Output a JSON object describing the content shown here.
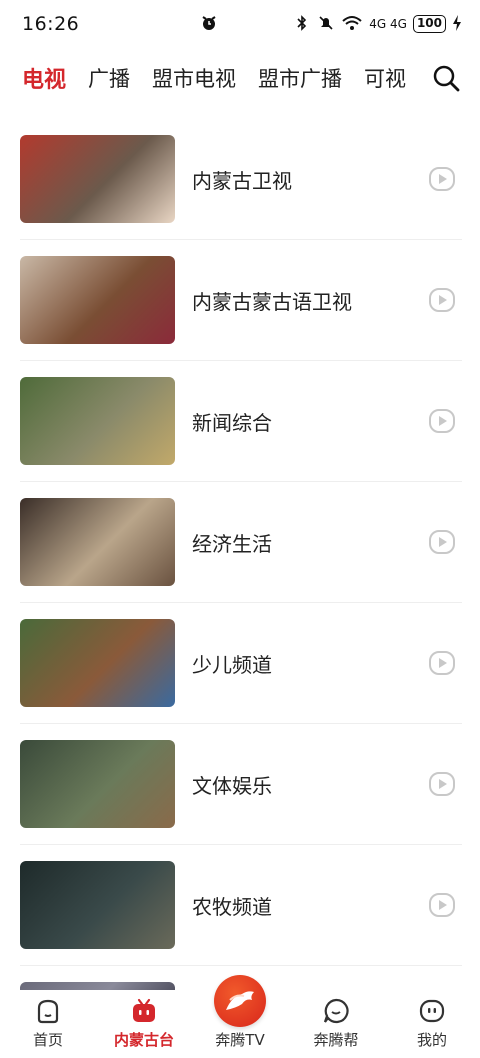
{
  "status_bar": {
    "time": "16:26",
    "network": "4G 4G",
    "battery": "100"
  },
  "top_tabs": [
    {
      "label": "电视",
      "active": true
    },
    {
      "label": "广播",
      "active": false
    },
    {
      "label": "盟市电视",
      "active": false
    },
    {
      "label": "盟市广播",
      "active": false
    },
    {
      "label": "可视",
      "active": false
    }
  ],
  "channels": [
    {
      "name": "内蒙古卫视",
      "thumb_colors": [
        "#b23a2e",
        "#6b5a4c",
        "#e9d6c4"
      ]
    },
    {
      "name": "内蒙古蒙古语卫视",
      "thumb_colors": [
        "#c9b8a6",
        "#7a4e34",
        "#8b2a3a"
      ]
    },
    {
      "name": "新闻综合",
      "thumb_colors": [
        "#4f6b3a",
        "#8a8a6a",
        "#c2a96a"
      ]
    },
    {
      "name": "经济生活",
      "thumb_colors": [
        "#3a2e28",
        "#b9a58a",
        "#6a5240"
      ]
    },
    {
      "name": "少儿频道",
      "thumb_colors": [
        "#4a6a3a",
        "#8a5a3a",
        "#3a6aa0"
      ]
    },
    {
      "name": "文体娱乐",
      "thumb_colors": [
        "#3a4a3a",
        "#6a7a5a",
        "#8a6a4a"
      ]
    },
    {
      "name": "农牧频道",
      "thumb_colors": [
        "#1e2a2a",
        "#3a4a4a",
        "#6a6a5a"
      ]
    },
    {
      "name": "",
      "thumb_colors": [
        "#6a6a7a",
        "#8a8a9a",
        "#4a4a5a"
      ]
    }
  ],
  "bottom_nav": [
    {
      "label": "首页",
      "icon": "home-icon",
      "active": false
    },
    {
      "label": "内蒙古台",
      "icon": "tv-icon",
      "active": true
    },
    {
      "label": "奔腾TV",
      "icon": "horse-logo-icon",
      "active": false
    },
    {
      "label": "奔腾帮",
      "icon": "chat-bubble-icon",
      "active": false
    },
    {
      "label": "我的",
      "icon": "profile-face-icon",
      "active": false
    }
  ],
  "colors": {
    "accent": "#d4272c",
    "play_icon": "#c8c8c8"
  }
}
